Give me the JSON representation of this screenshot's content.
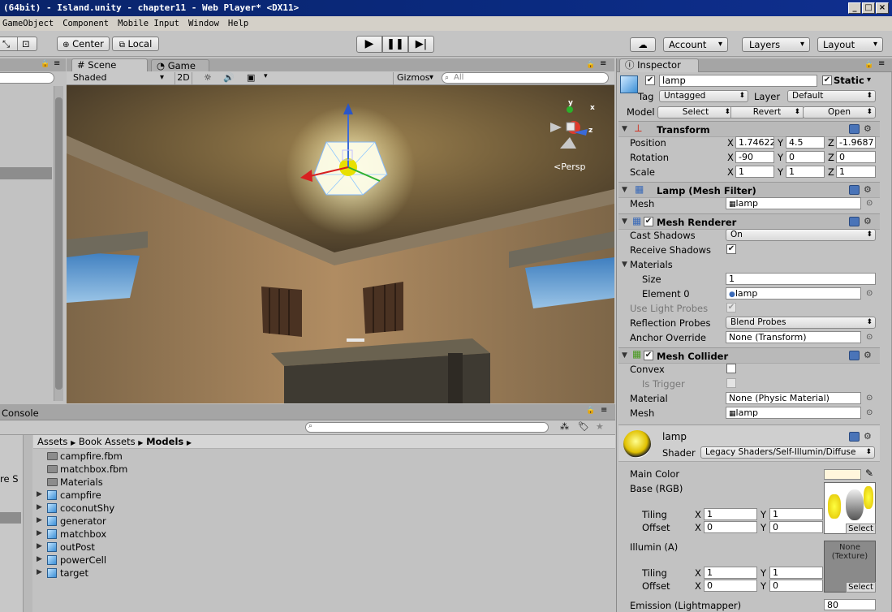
{
  "window": {
    "title": "(64bit) - Island.unity - chapter11 - Web Player* <DX11>"
  },
  "menu": [
    "GameObject",
    "Component",
    "Mobile Input",
    "Window",
    "Help"
  ],
  "toolbar": {
    "center": "Center",
    "local": "Local",
    "account": "Account",
    "layers": "Layers",
    "layout": "Layout"
  },
  "scene": {
    "tab_scene": "Scene",
    "tab_game": "Game",
    "shaded": "Shaded",
    "mode_2d": "2D",
    "gizmos": "Gizmos",
    "search_placeholder": "All",
    "persp": "Persp"
  },
  "console": {
    "tab": "Console",
    "left_text": "re S"
  },
  "project": {
    "breadcrumb": [
      "Assets",
      "Book Assets",
      "Models"
    ],
    "items": [
      {
        "name": "campfire.fbm",
        "kind": "folder"
      },
      {
        "name": "matchbox.fbm",
        "kind": "folder"
      },
      {
        "name": "Materials",
        "kind": "folder"
      },
      {
        "name": "campfire",
        "kind": "model"
      },
      {
        "name": "coconutShy",
        "kind": "model"
      },
      {
        "name": "generator",
        "kind": "model"
      },
      {
        "name": "matchbox",
        "kind": "model"
      },
      {
        "name": "outPost",
        "kind": "model"
      },
      {
        "name": "powerCell",
        "kind": "model"
      },
      {
        "name": "target",
        "kind": "model"
      }
    ]
  },
  "inspector": {
    "tab": "Inspector",
    "object_name": "lamp",
    "static": "Static",
    "tag_label": "Tag",
    "tag_value": "Untagged",
    "layer_label": "Layer",
    "layer_value": "Default",
    "model_label": "Model",
    "select": "Select",
    "revert": "Revert",
    "open": "Open",
    "transform": {
      "title": "Transform",
      "position": "Position",
      "rotation": "Rotation",
      "scale": "Scale",
      "pos": [
        "1.74622",
        "4.5",
        "-1.9687"
      ],
      "rot": [
        "-90",
        "0",
        "0"
      ],
      "scl": [
        "1",
        "1",
        "1"
      ]
    },
    "mesh_filter": {
      "title": "Lamp (Mesh Filter)",
      "mesh_label": "Mesh",
      "mesh_value": "lamp"
    },
    "mesh_renderer": {
      "title": "Mesh Renderer",
      "cast_shadows": "Cast Shadows",
      "cast_value": "On",
      "receive_shadows": "Receive Shadows",
      "materials": "Materials",
      "size": "Size",
      "size_value": "1",
      "element0": "Element 0",
      "element0_value": "lamp",
      "use_light_probes": "Use Light Probes",
      "reflection_probes": "Reflection Probes",
      "reflection_value": "Blend Probes",
      "anchor_override": "Anchor Override",
      "anchor_value": "None (Transform)"
    },
    "mesh_collider": {
      "title": "Mesh Collider",
      "convex": "Convex",
      "is_trigger": "Is Trigger",
      "material": "Material",
      "material_value": "None (Physic Material)",
      "mesh": "Mesh",
      "mesh_value": "lamp"
    },
    "material": {
      "name": "lamp",
      "shader_label": "Shader",
      "shader_value": "Legacy Shaders/Self-Illumin/Diffuse",
      "main_color": "Main Color",
      "base_rgb": "Base (RGB)",
      "tiling": "Tiling",
      "offset": "Offset",
      "tiling_vals": [
        "1",
        "1"
      ],
      "offset_vals": [
        "0",
        "0"
      ],
      "illum": "Illumin (A)",
      "illum_tiling": [
        "1",
        "1"
      ],
      "illum_offset": [
        "0",
        "0"
      ],
      "none_texture": "None\n(Texture)",
      "emission": "Emission (Lightmapper)",
      "emission_value": "80",
      "select": "Select"
    },
    "axis": {
      "x": "X",
      "y": "Y",
      "z": "Z"
    }
  },
  "colors": {
    "title_bg": "#0a246a",
    "main_color_swatch": "#fff6dc",
    "panel": "#c2c2c2"
  }
}
